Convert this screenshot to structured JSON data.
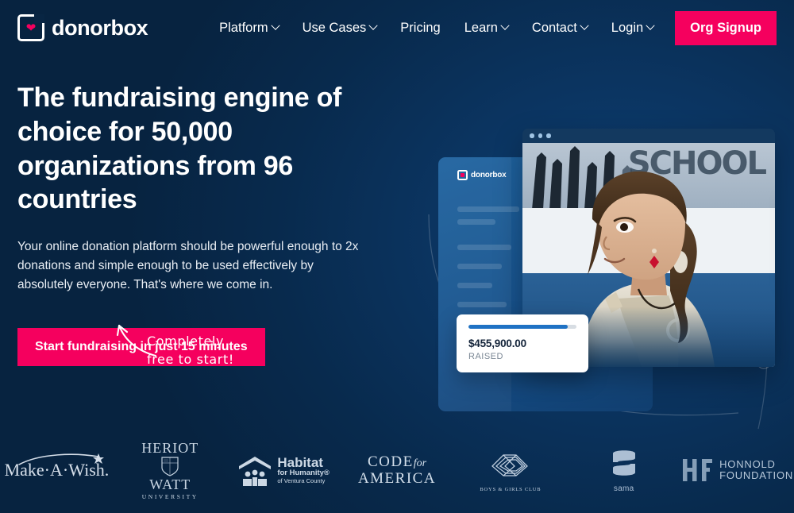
{
  "brand": {
    "name": "donorbox",
    "heart_icon": "heart-icon"
  },
  "nav": {
    "items": [
      {
        "label": "Platform",
        "has_dropdown": true
      },
      {
        "label": "Use Cases",
        "has_dropdown": true
      },
      {
        "label": "Pricing",
        "has_dropdown": false
      },
      {
        "label": "Learn",
        "has_dropdown": true
      },
      {
        "label": "Contact",
        "has_dropdown": true
      },
      {
        "label": "Login",
        "has_dropdown": true
      }
    ],
    "cta_label": "Org Signup"
  },
  "hero": {
    "headline": "The fundraising engine of choice for 50,000 organizations from 96 countries",
    "subcopy": "Your online donation platform should be powerful enough to 2x donations and simple enough to be used effectively by absolutely everyone. That's where we come in.",
    "cta_label": "Start fundraising in just 15 minutes",
    "note_line1": "Completely",
    "note_line2": "free to start!"
  },
  "hero_art": {
    "dashboard_brand": "donorbox",
    "browser_scene_word": "SCHOOL",
    "stat_card": {
      "amount": "$455,900.00",
      "label": "RAISED",
      "progress_percent": 92
    }
  },
  "logos": [
    {
      "name": "make-a-wish",
      "text": "Make",
      "mid": "A",
      "end": "Wish"
    },
    {
      "name": "heriot-watt",
      "line1": "HERIOT",
      "line2": "WATT",
      "line3": "UNIVERSITY"
    },
    {
      "name": "habitat-for-humanity",
      "t1": "Habitat",
      "t2": "for Humanity®",
      "t3": "of Ventura County"
    },
    {
      "name": "code-for-america",
      "c1": "CODE",
      "c2": "for",
      "c3": "AMERICA"
    },
    {
      "name": "boys-and-girls-club",
      "caption": "BOYS & GIRLS CLUB"
    },
    {
      "name": "sama",
      "caption": "sama"
    },
    {
      "name": "honnold-foundation",
      "h1": "HONNOLD",
      "h2": "FOUNDATION"
    }
  ],
  "colors": {
    "accent_pink": "#f5005e",
    "bg_navy": "#082543",
    "bg_navy_light": "#0a3463",
    "widget_blue": "#1f72c4"
  }
}
